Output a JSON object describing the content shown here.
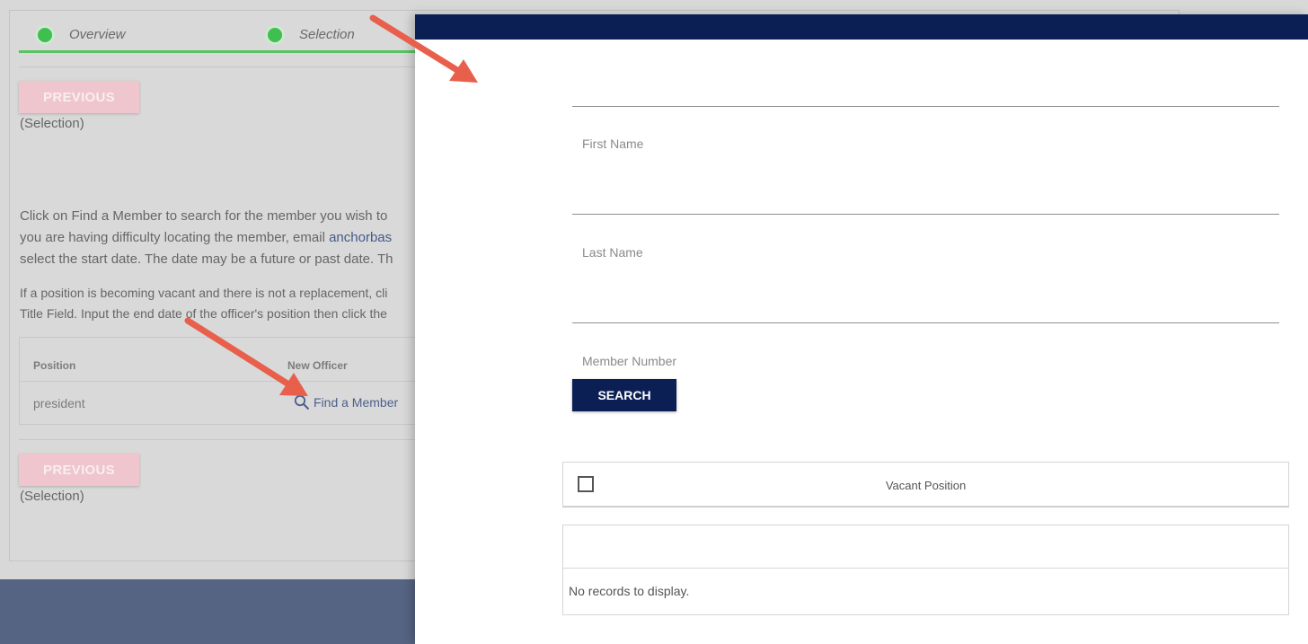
{
  "steps": [
    {
      "label": "Overview"
    },
    {
      "label": "Selection"
    }
  ],
  "previous_label": "PREVIOUS",
  "previous_sub": "(Selection)",
  "instructions": {
    "line1": "Click on Find a Member to search for the member you wish to",
    "line2_a": "you are having difficulty locating the member, email ",
    "line2_email": "anchorbas",
    "line3": "select the start date. The date may be a future or past date.  Th",
    "line4": "If a position is becoming vacant and there is not a replacement, cli",
    "line5": "Title Field.  Input the end date of the officer's position then click the"
  },
  "officers_table": {
    "columns": [
      "Position",
      "New Officer"
    ],
    "rows": [
      {
        "position": "president",
        "action": "Find a Member"
      }
    ]
  },
  "search_panel": {
    "fields": [
      {
        "label": "First Name"
      },
      {
        "label": "Last Name"
      },
      {
        "label": "Member Number"
      }
    ],
    "search_label": "SEARCH",
    "vacant_label": "Vacant Position",
    "empty_text": "No records to display."
  },
  "colors": {
    "navy": "#0c1f55",
    "step_green": "#3fbf4f",
    "arrow": "#e8604c",
    "previous_btn": "#efc6cd"
  },
  "icons": [
    "search-icon",
    "step-complete-icon",
    "annotation-arrow"
  ]
}
